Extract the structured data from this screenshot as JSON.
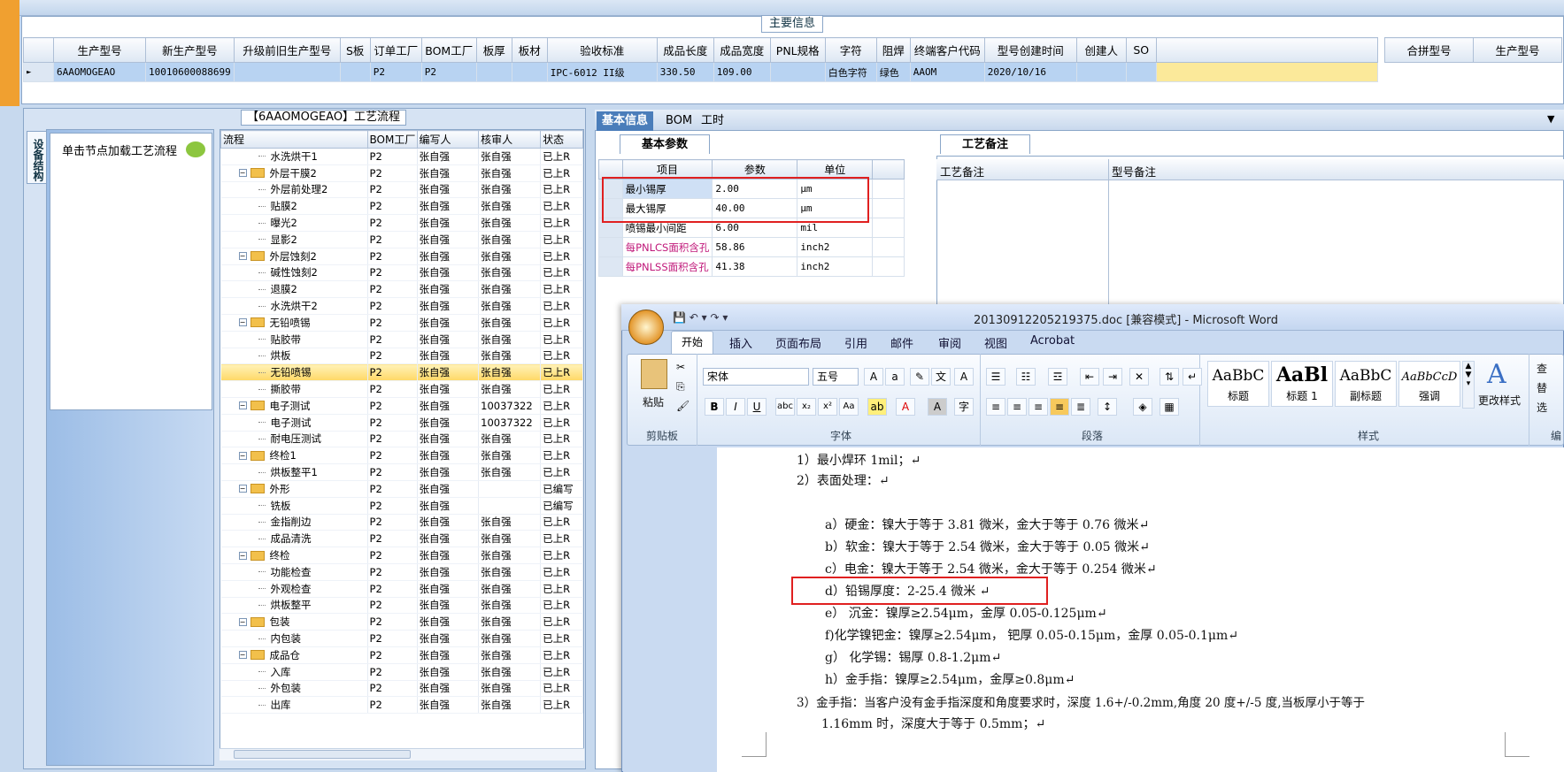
{
  "main_info": {
    "title": "主要信息",
    "columns": [
      "生产型号",
      "新生产型号",
      "升级前旧生产型号",
      "S板",
      "订单工厂",
      "BOM工厂",
      "板厚",
      "板材",
      "验收标准",
      "成品长度",
      "成品宽度",
      "PNL规格",
      "字符",
      "阻焊",
      "终端客户代码",
      "型号创建时间",
      "创建人",
      "SO"
    ],
    "row": [
      "6AAOMOGEAO",
      "10010600088699",
      "",
      "",
      "P2",
      "P2",
      "",
      "",
      "IPC-6012 II级",
      "330.50",
      "109.00",
      "",
      "白色字符",
      "绿色",
      "AAOM",
      "2020/10/16",
      "",
      ""
    ],
    "right_columns": [
      "合拼型号",
      "生产型号"
    ]
  },
  "process": {
    "title": "【6AAOMOGEAO】工艺流程",
    "side_tab": "设备结构",
    "load_label": "单击节点加载工艺流程",
    "columns": [
      "流程",
      "BOM工厂",
      "编写人",
      "核审人",
      "状态"
    ],
    "rows": [
      {
        "name": "水洗烘干1",
        "level": 2,
        "folder": false,
        "bom": "P2",
        "writer": "张自强",
        "reviewer": "张自强",
        "status": "已上R"
      },
      {
        "name": "外层干膜2",
        "level": 1,
        "folder": true,
        "bom": "P2",
        "writer": "张自强",
        "reviewer": "张自强",
        "status": "已上R"
      },
      {
        "name": "外层前处理2",
        "level": 2,
        "folder": false,
        "bom": "P2",
        "writer": "张自强",
        "reviewer": "张自强",
        "status": "已上R"
      },
      {
        "name": "贴膜2",
        "level": 2,
        "folder": false,
        "bom": "P2",
        "writer": "张自强",
        "reviewer": "张自强",
        "status": "已上R"
      },
      {
        "name": "曝光2",
        "level": 2,
        "folder": false,
        "bom": "P2",
        "writer": "张自强",
        "reviewer": "张自强",
        "status": "已上R"
      },
      {
        "name": "显影2",
        "level": 2,
        "folder": false,
        "bom": "P2",
        "writer": "张自强",
        "reviewer": "张自强",
        "status": "已上R"
      },
      {
        "name": "外层蚀刻2",
        "level": 1,
        "folder": true,
        "bom": "P2",
        "writer": "张自强",
        "reviewer": "张自强",
        "status": "已上R"
      },
      {
        "name": "碱性蚀刻2",
        "level": 2,
        "folder": false,
        "bom": "P2",
        "writer": "张自强",
        "reviewer": "张自强",
        "status": "已上R"
      },
      {
        "name": "退膜2",
        "level": 2,
        "folder": false,
        "bom": "P2",
        "writer": "张自强",
        "reviewer": "张自强",
        "status": "已上R"
      },
      {
        "name": "水洗烘干2",
        "level": 2,
        "folder": false,
        "bom": "P2",
        "writer": "张自强",
        "reviewer": "张自强",
        "status": "已上R"
      },
      {
        "name": "无铅喷锡",
        "level": 1,
        "folder": true,
        "bom": "P2",
        "writer": "张自强",
        "reviewer": "张自强",
        "status": "已上R"
      },
      {
        "name": "贴胶带",
        "level": 2,
        "folder": false,
        "bom": "P2",
        "writer": "张自强",
        "reviewer": "张自强",
        "status": "已上R"
      },
      {
        "name": "烘板",
        "level": 2,
        "folder": false,
        "bom": "P2",
        "writer": "张自强",
        "reviewer": "张自强",
        "status": "已上R"
      },
      {
        "name": "无铅喷锡",
        "level": 2,
        "folder": false,
        "bom": "P2",
        "writer": "张自强",
        "reviewer": "张自强",
        "status": "已上R",
        "highlight": true
      },
      {
        "name": "撕胶带",
        "level": 2,
        "folder": false,
        "bom": "P2",
        "writer": "张自强",
        "reviewer": "张自强",
        "status": "已上R"
      },
      {
        "name": "电子测试",
        "level": 1,
        "folder": true,
        "bom": "P2",
        "writer": "张自强",
        "reviewer": "10037322",
        "status": "已上R"
      },
      {
        "name": "电子测试",
        "level": 2,
        "folder": false,
        "bom": "P2",
        "writer": "张自强",
        "reviewer": "10037322",
        "status": "已上R"
      },
      {
        "name": "耐电压测试",
        "level": 2,
        "folder": false,
        "bom": "P2",
        "writer": "张自强",
        "reviewer": "张自强",
        "status": "已上R"
      },
      {
        "name": "终检1",
        "level": 1,
        "folder": true,
        "bom": "P2",
        "writer": "张自强",
        "reviewer": "张自强",
        "status": "已上R"
      },
      {
        "name": "烘板整平1",
        "level": 2,
        "folder": false,
        "bom": "P2",
        "writer": "张自强",
        "reviewer": "张自强",
        "status": "已上R"
      },
      {
        "name": "外形",
        "level": 1,
        "folder": true,
        "bom": "P2",
        "writer": "张自强",
        "reviewer": "",
        "status": "已编写"
      },
      {
        "name": "铣板",
        "level": 2,
        "folder": false,
        "bom": "P2",
        "writer": "张自强",
        "reviewer": "",
        "status": "已编写"
      },
      {
        "name": "金指削边",
        "level": 2,
        "folder": false,
        "bom": "P2",
        "writer": "张自强",
        "reviewer": "张自强",
        "status": "已上R"
      },
      {
        "name": "成品清洗",
        "level": 2,
        "folder": false,
        "bom": "P2",
        "writer": "张自强",
        "reviewer": "张自强",
        "status": "已上R"
      },
      {
        "name": "终检",
        "level": 1,
        "folder": true,
        "bom": "P2",
        "writer": "张自强",
        "reviewer": "张自强",
        "status": "已上R"
      },
      {
        "name": "功能检查",
        "level": 2,
        "folder": false,
        "bom": "P2",
        "writer": "张自强",
        "reviewer": "张自强",
        "status": "已上R"
      },
      {
        "name": "外观检查",
        "level": 2,
        "folder": false,
        "bom": "P2",
        "writer": "张自强",
        "reviewer": "张自强",
        "status": "已上R"
      },
      {
        "name": "烘板整平",
        "level": 2,
        "folder": false,
        "bom": "P2",
        "writer": "张自强",
        "reviewer": "张自强",
        "status": "已上R"
      },
      {
        "name": "包装",
        "level": 1,
        "folder": true,
        "bom": "P2",
        "writer": "张自强",
        "reviewer": "张自强",
        "status": "已上R"
      },
      {
        "name": "内包装",
        "level": 2,
        "folder": false,
        "bom": "P2",
        "writer": "张自强",
        "reviewer": "张自强",
        "status": "已上R"
      },
      {
        "name": "成品仓",
        "level": 1,
        "folder": true,
        "bom": "P2",
        "writer": "张自强",
        "reviewer": "张自强",
        "status": "已上R"
      },
      {
        "name": "入库",
        "level": 2,
        "folder": false,
        "bom": "P2",
        "writer": "张自强",
        "reviewer": "张自强",
        "status": "已上R"
      },
      {
        "name": "外包装",
        "level": 2,
        "folder": false,
        "bom": "P2",
        "writer": "张自强",
        "reviewer": "张自强",
        "status": "已上R"
      },
      {
        "name": "出库",
        "level": 2,
        "folder": false,
        "bom": "P2",
        "writer": "张自强",
        "reviewer": "张自强",
        "status": "已上R"
      }
    ]
  },
  "right": {
    "tabs": [
      "基本信息",
      "BOM",
      "工时"
    ],
    "sub_tab": "基本参数",
    "note_tab": "工艺备注",
    "param_columns": [
      "项目",
      "参数",
      "单位"
    ],
    "params": [
      {
        "item": "最小锡厚",
        "value": "2.00",
        "unit": "μm",
        "magenta": false
      },
      {
        "item": "最大锡厚",
        "value": "40.00",
        "unit": "μm",
        "magenta": false
      },
      {
        "item": "喷锡最小间距",
        "value": "6.00",
        "unit": "mil",
        "magenta": false
      },
      {
        "item": "每PNLCS面积含孔",
        "value": "58.86",
        "unit": "inch2",
        "magenta": true
      },
      {
        "item": "每PNLSS面积含孔",
        "value": "41.38",
        "unit": "inch2",
        "magenta": true
      }
    ],
    "note_columns": [
      "工艺备注",
      "型号备注"
    ]
  },
  "word": {
    "title": "20130912205219375.doc [兼容模式] - Microsoft Word",
    "tabs": [
      "开始",
      "插入",
      "页面布局",
      "引用",
      "邮件",
      "审阅",
      "视图",
      "Acrobat"
    ],
    "clipboard": {
      "paste": "粘贴",
      "label": "剪贴板"
    },
    "font": {
      "name": "宋体",
      "size": "五号",
      "label": "字体"
    },
    "paragraph_label": "段落",
    "styles": [
      {
        "preview": "AaBbC",
        "name": "标题"
      },
      {
        "preview": "AaBl",
        "name": "标题 1"
      },
      {
        "preview": "AaBbC",
        "name": "副标题"
      },
      {
        "preview": "AaBbCcD",
        "name": "强调"
      }
    ],
    "change_styles": "更改样式",
    "styles_label": "样式",
    "edit_partial": [
      "查",
      "替",
      "选"
    ],
    "edit_label": "编",
    "lines": [
      "1）最小焊环 1mil；↵",
      "2）表面处理：↵",
      "a）硬金：镍大于等于 3.81 微米，金大于等于 0.76 微米↵",
      "b）软金：镍大于等于 2.54 微米，金大于等于 0.05 微米↵",
      "c）电金：镍大于等于 2.54 微米，金大于等于 0.254 微米↵",
      "d）铅锡厚度：2-25.4 微米 ↵",
      "e） 沉金：镍厚≥2.54μm，金厚 0.05-0.125μm↵",
      "f)化学镍钯金：镍厚≥2.54μm， 钯厚 0.05-0.15μm，金厚 0.05-0.1μm↵",
      "g） 化学锡：锡厚 0.8-1.2μm↵",
      "h）金手指：镍厚≥2.54μm，金厚≥0.8μm↵",
      "3）金手指：当客户没有金手指深度和角度要求时，深度 1.6+/-0.2mm,角度 20 度+/-5 度,当板厚小于等于",
      "1.16mm 时，深度大于等于 0.5mm；↵"
    ]
  }
}
